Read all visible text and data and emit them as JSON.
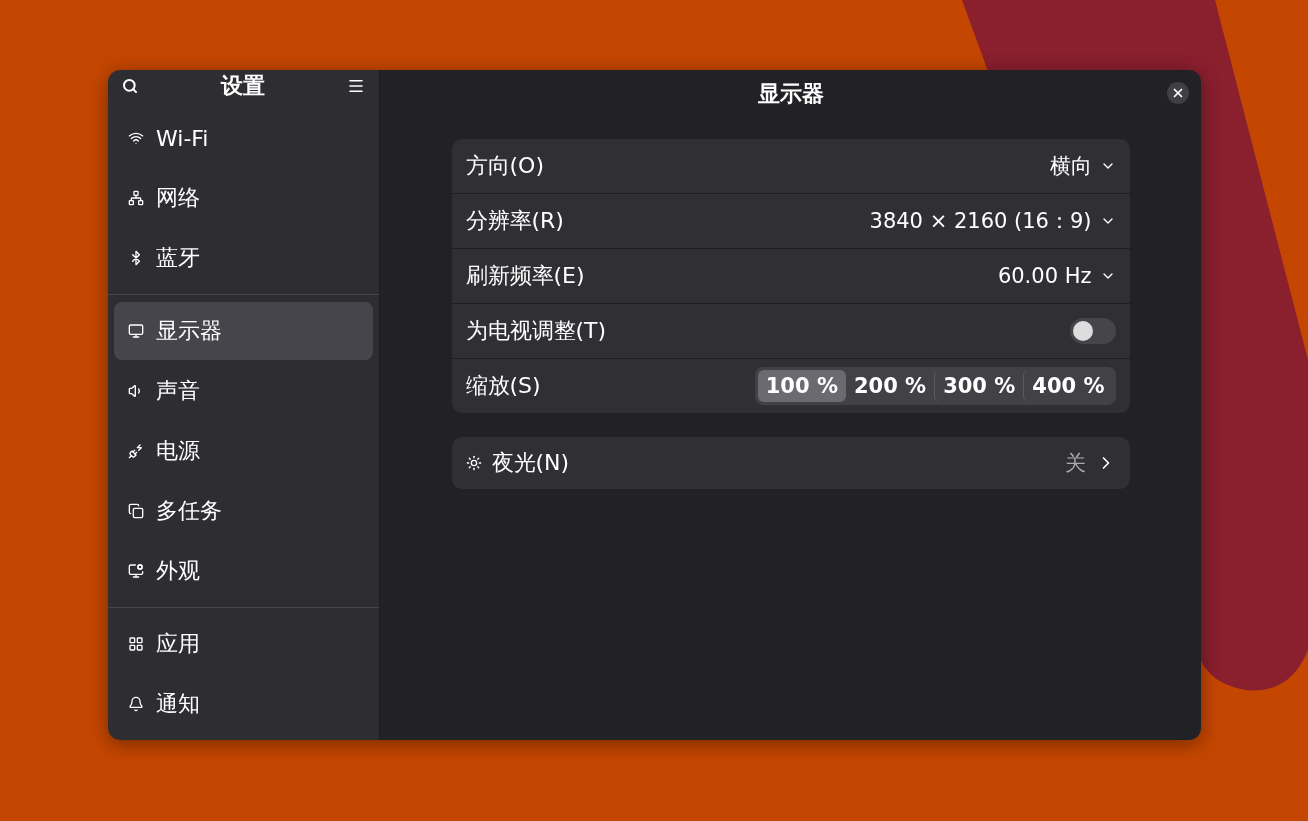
{
  "sidebar": {
    "title": "设置",
    "groups": [
      {
        "items": [
          {
            "label": "Wi-Fi",
            "selected": false
          },
          {
            "label": "网络",
            "selected": false
          },
          {
            "label": "蓝牙",
            "selected": false
          }
        ]
      },
      {
        "items": [
          {
            "label": "显示器",
            "selected": true
          },
          {
            "label": "声音",
            "selected": false
          },
          {
            "label": "电源",
            "selected": false
          },
          {
            "label": "多任务",
            "selected": false
          },
          {
            "label": "外观",
            "selected": false
          }
        ]
      },
      {
        "items": [
          {
            "label": "应用",
            "selected": false
          },
          {
            "label": "通知",
            "selected": false
          }
        ]
      }
    ]
  },
  "content": {
    "title": "显示器",
    "display_rows": [
      {
        "kind": "dropdown",
        "label": "方向(O)",
        "value": "横向"
      },
      {
        "kind": "dropdown",
        "label": "分辨率(R)",
        "value": "3840 × 2160 (16：9)"
      },
      {
        "kind": "dropdown",
        "label": "刷新频率(E)",
        "value": "60.00 Hz"
      },
      {
        "kind": "switch",
        "label": "为电视调整(T)",
        "on": false
      },
      {
        "kind": "segmented",
        "label": "缩放(S)",
        "options": [
          {
            "label": "100 %",
            "selected": true
          },
          {
            "label": "200 %",
            "selected": false
          },
          {
            "label": "300 %",
            "selected": false
          },
          {
            "label": "400 %",
            "selected": false
          }
        ]
      }
    ],
    "night_light": {
      "label": "夜光(N)",
      "value": "关"
    }
  }
}
